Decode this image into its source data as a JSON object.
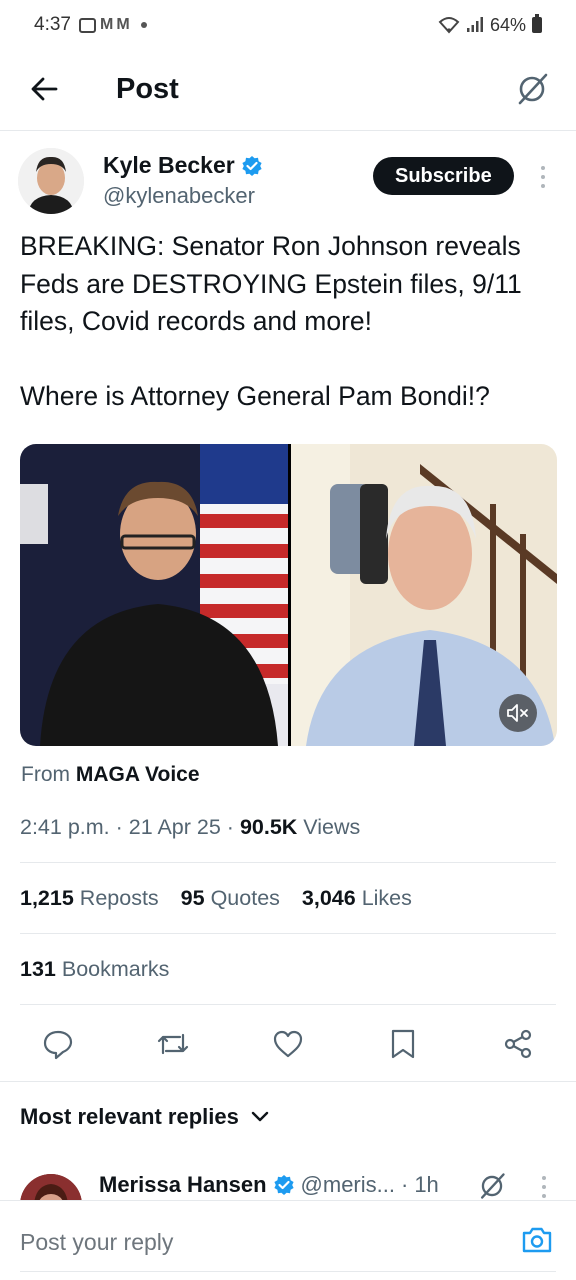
{
  "status_bar": {
    "time": "4:37",
    "battery": "64%",
    "icons": [
      "gallery-icon",
      "gmail-icon",
      "gmail-icon",
      "dot-icon",
      "wifi-icon",
      "signal-icon",
      "battery-icon"
    ]
  },
  "header": {
    "title": "Post",
    "back_icon": "arrow-left-icon",
    "grok_icon": "grok-icon"
  },
  "author": {
    "name": "Kyle Becker",
    "handle": "@kylenabecker",
    "verified": true,
    "subscribe_label": "Subscribe"
  },
  "tweet": {
    "paragraphs": [
      "BREAKING: Senator Ron Johnson reveals Feds are DESTROYING Epstein files, 9/11 files, Covid records and more!",
      "Where is Attorney General Pam Bondi!?"
    ]
  },
  "media": {
    "type": "video",
    "mute_icon": "volume-muted-icon"
  },
  "source": {
    "prefix": "From",
    "name": "MAGA Voice"
  },
  "meta": {
    "time": "2:41 p.m.",
    "date": "21 Apr 25",
    "views_count": "90.5K",
    "views_label": "Views"
  },
  "stats": {
    "reposts_count": "1,215",
    "reposts_label": "Reposts",
    "quotes_count": "95",
    "quotes_label": "Quotes",
    "likes_count": "3,046",
    "likes_label": "Likes",
    "bookmarks_count": "131",
    "bookmarks_label": "Bookmarks"
  },
  "actions": [
    "reply-icon",
    "retweet-icon",
    "like-icon",
    "bookmark-icon",
    "share-icon"
  ],
  "replies": {
    "header_label": "Most relevant replies",
    "items": [
      {
        "name": "Merissa Hansen",
        "handle": "@meris...",
        "time": "1h",
        "verified": true
      }
    ]
  },
  "composer": {
    "placeholder": "Post your reply"
  },
  "colors": {
    "text": "#0f1419",
    "secondary": "#536471",
    "verified": "#1d9bf0",
    "button_bg": "#0f1419",
    "accent_camera": "#1d9bf0"
  }
}
